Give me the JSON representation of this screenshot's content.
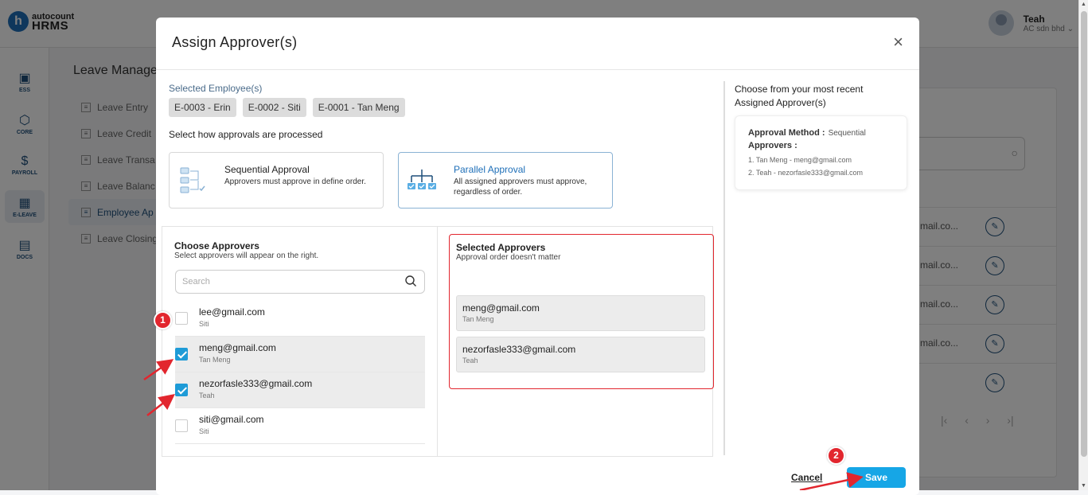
{
  "app": {
    "logo_letter": "h",
    "logo_top": "autocount",
    "logo_bottom": "HRMS",
    "user_name": "Teah",
    "user_company": "AC sdn bhd"
  },
  "sidebar": [
    {
      "label": "ESS",
      "icon": "ess-icon"
    },
    {
      "label": "CORE",
      "icon": "core-icon"
    },
    {
      "label": "PAYROLL",
      "icon": "payroll-icon"
    },
    {
      "label": "E-LEAVE",
      "icon": "e-leave-icon"
    },
    {
      "label": "DOCS",
      "icon": "docs-icon"
    }
  ],
  "background": {
    "title": "Leave Manage",
    "menu": [
      "Leave Entry",
      "Leave Credit",
      "Leave Transa",
      "Leave Balanc",
      "Employee Ap",
      "Leave Closing"
    ],
    "rows": [
      "mail.co...",
      "mail.co...",
      "mail.co...",
      "mail.co...",
      ""
    ],
    "pager": "|‹  ‹  ›  ›|"
  },
  "modal": {
    "title": "Assign Approver(s)",
    "close": "×",
    "selected_employees_label": "Selected Employee(s)",
    "employees": [
      "E-0003 - Erin",
      "E-0002 - Siti",
      "E-0001 - Tan Meng"
    ],
    "how_label": "Select how approvals are processed",
    "methods": [
      {
        "title": "Sequential Approval",
        "desc": "Approvers must approve in define order.",
        "selected": false
      },
      {
        "title": "Parallel Approval",
        "desc": "All assigned approvers must approve, regardless of order.",
        "selected": true
      }
    ],
    "choose": {
      "title": "Choose Approvers",
      "subtitle": "Select approvers will appear on the right.",
      "search_placeholder": "Search",
      "items": [
        {
          "email": "lee@gmail.com",
          "name": "Siti",
          "checked": false
        },
        {
          "email": "meng@gmail.com",
          "name": "Tan Meng",
          "checked": true
        },
        {
          "email": "nezorfasle333@gmail.com",
          "name": "Teah",
          "checked": true
        },
        {
          "email": "siti@gmail.com",
          "name": "Siti",
          "checked": false
        }
      ]
    },
    "selected": {
      "title": "Selected Approvers",
      "subtitle": "Approval order doesn't matter",
      "items": [
        {
          "email": "meng@gmail.com",
          "name": "Tan Meng"
        },
        {
          "email": "nezorfasle333@gmail.com",
          "name": "Teah"
        }
      ]
    },
    "recent": {
      "title": "Choose from your most recent Assigned Approver(s)",
      "method_label": "Approval Method :",
      "method_value": "Sequential",
      "approvers_label": "Approvers :",
      "lines": [
        "1. Tan Meng - meng@gmail.com",
        "2. Teah - nezorfasle333@gmail.com"
      ]
    },
    "footer": {
      "cancel": "Cancel",
      "save": "Save"
    }
  },
  "annotations": {
    "badge1": "1",
    "badge2": "2",
    "color": "#e2262e"
  }
}
